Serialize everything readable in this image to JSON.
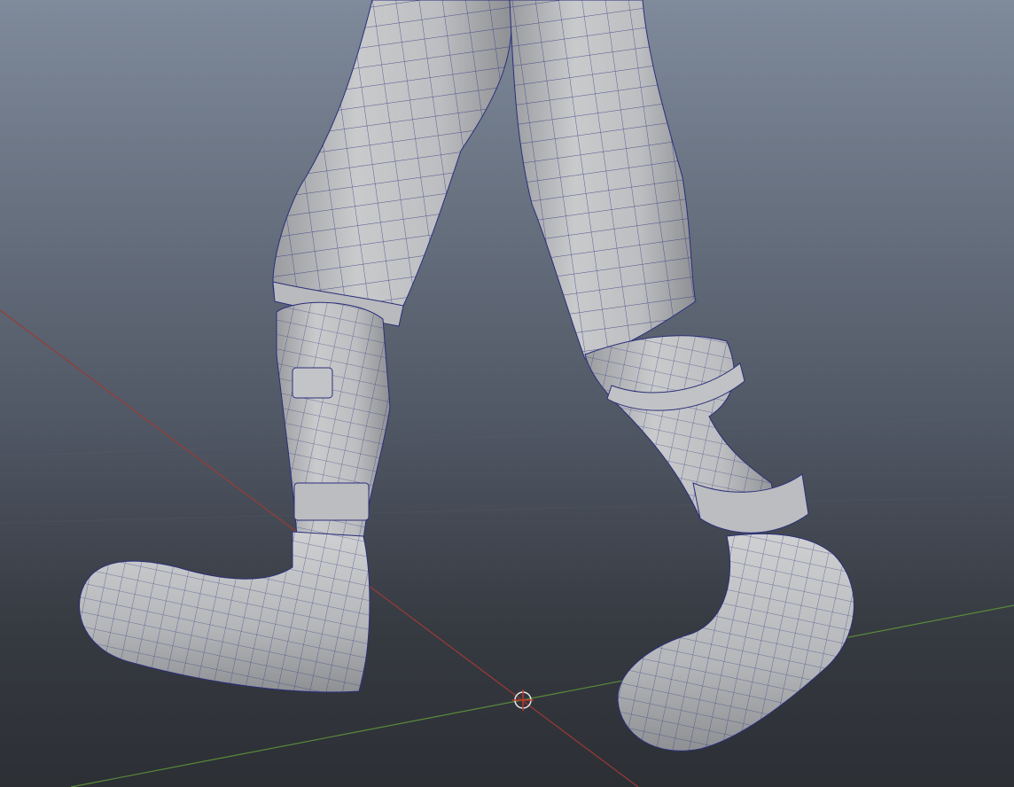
{
  "viewport": {
    "background_top": "#7f8a9b",
    "background_bottom": "#2c2f34",
    "mesh_color": "#bfc1c4",
    "wire_color": "#2b2f7a",
    "x_axis_color": "#9b3a36",
    "z_axis_color": "#5a8a3a"
  },
  "scene": {
    "model": "character-legs-mesh",
    "display_mode": "smooth-shade-wireframe",
    "manipulator": "pivot-crosshair-icon"
  }
}
